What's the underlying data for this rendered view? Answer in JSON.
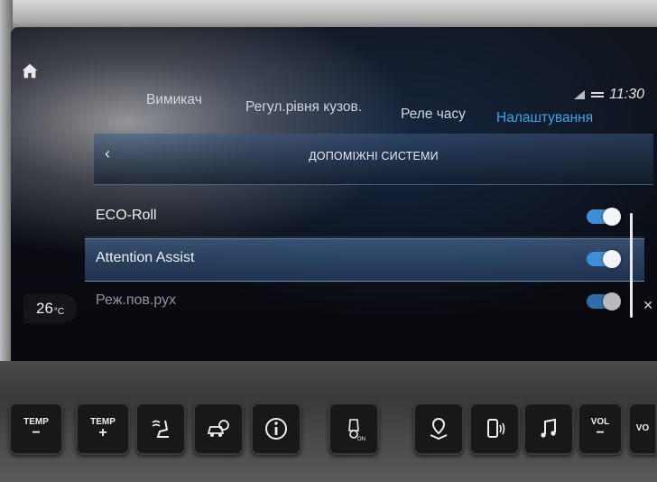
{
  "status": {
    "time": "11:30"
  },
  "tabs": [
    {
      "label": "Вимикач",
      "active": false
    },
    {
      "label": "Регул.рівня кузов.",
      "active": false
    },
    {
      "label": "Реле часу",
      "active": false
    },
    {
      "label": "Налаштування",
      "active": true
    }
  ],
  "submenu": {
    "back_icon": "chevron-left-icon",
    "title": "ДОПОМІЖНІ СИСТЕМИ"
  },
  "settings": [
    {
      "label": "ECO-Roll",
      "enabled": true
    },
    {
      "label": "Attention Assist",
      "enabled": true,
      "highlighted": true
    },
    {
      "label": "Реж.пов.рух",
      "enabled": true,
      "dimmed": true
    }
  ],
  "climate": {
    "temperature": "26",
    "unit": "°C"
  },
  "hardware_buttons": {
    "temp_minus": {
      "label": "TEMP",
      "sign": "−"
    },
    "temp_plus": {
      "label": "TEMP",
      "sign": "+"
    },
    "vol_minus": {
      "label": "VOL",
      "sign": "−"
    },
    "vol_plus": {
      "label": "VO"
    }
  },
  "colors": {
    "accent": "#3aa5ec",
    "toggle_on": "#3f8ed6",
    "highlight_row": "#4a76a8"
  }
}
